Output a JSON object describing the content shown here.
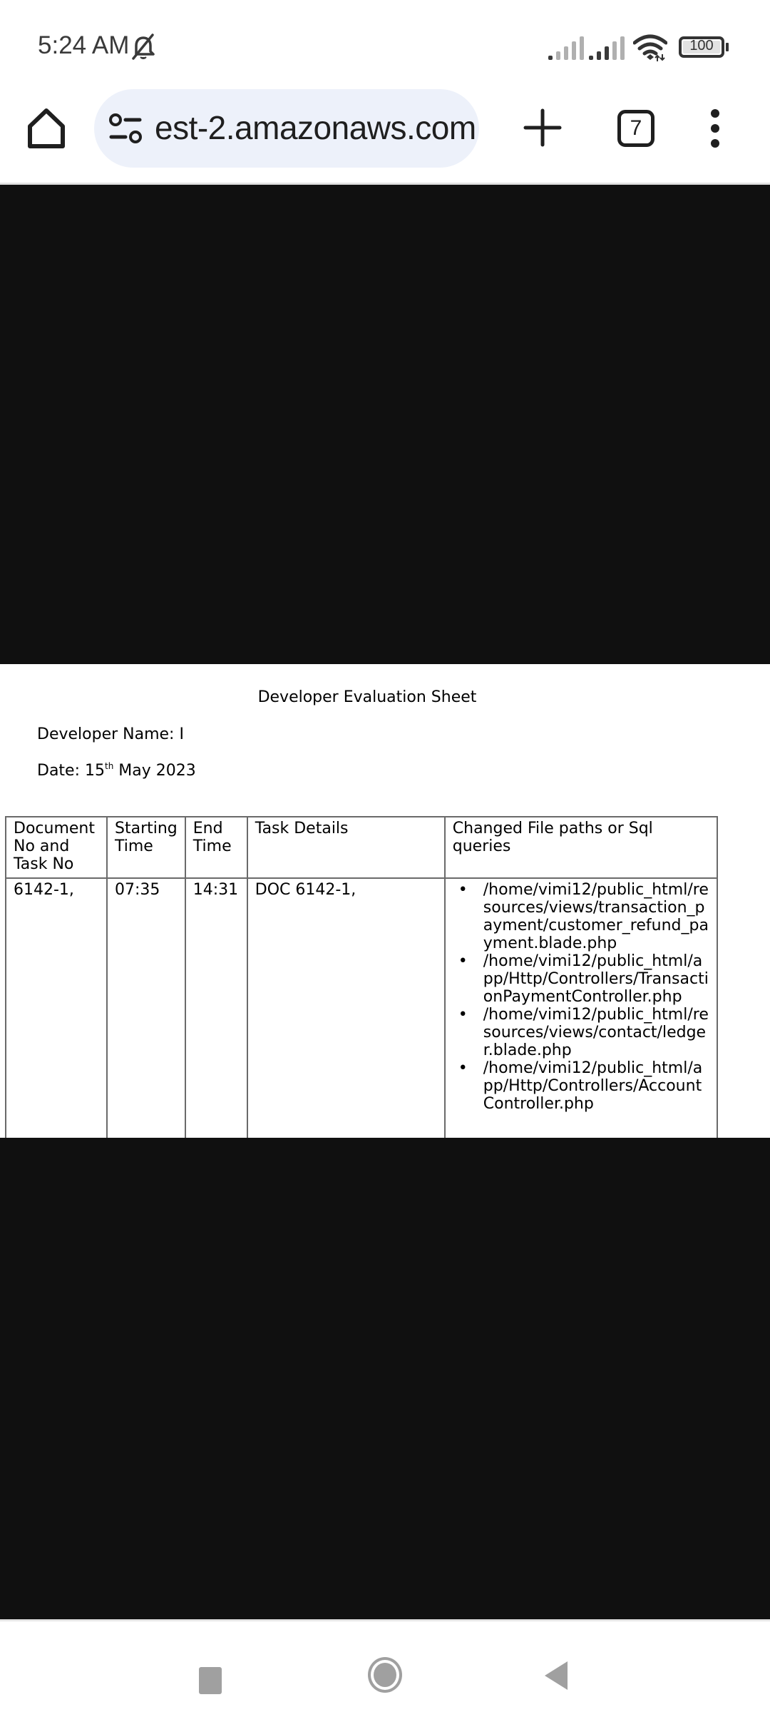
{
  "status_bar": {
    "time": "5:24 AM",
    "notification_icon": "bell-off-icon",
    "signal_icons": [
      "signal-sim1-icon",
      "signal-sim2-icon"
    ],
    "wifi_icon": "wifi-icon",
    "battery_level": "100"
  },
  "browser": {
    "url_display": "est-2.amazonaws.com",
    "tab_count": "7",
    "icons": [
      "home-icon",
      "site-settings-icon",
      "plus-icon",
      "tabs-icon",
      "more-vert-icon"
    ]
  },
  "document": {
    "title": "Developer Evaluation Sheet",
    "developer_name_label": "Developer Name: ",
    "developer_name_value": "I",
    "date_label": "Date: ",
    "date_day": "15",
    "date_suffix": "th",
    "date_rest": " May 2023",
    "table": {
      "headers": [
        "Document No and Task No",
        "Starting Time",
        "End Time",
        "Task Details",
        "Changed File paths or Sql queries"
      ],
      "rows": [
        {
          "doc_task_no": "6142-1,",
          "start_time": "07:35",
          "end_time": "14:31",
          "task_details": "DOC 6142-1,",
          "changed_files": [
            "/home/vimi12/public_html/resources/views/transaction_payment/customer_refund_payment.blade.php",
            "/home/vimi12/public_html/app/Http/Controllers/TransactionPaymentController.php",
            "/home/vimi12/public_html/resources/views/contact/ledger.blade.php",
            "/home/vimi12/public_html/app/Http/Controllers/AccountController.php"
          ]
        }
      ]
    }
  },
  "nav_bar": {
    "buttons": [
      "recent-apps",
      "home",
      "back"
    ]
  },
  "colors": {
    "url_bar_bg": "#edf1fa",
    "redacted_black": "#101010",
    "nav_gray": "#a0a0a0",
    "table_border": "#6a6a6a"
  }
}
